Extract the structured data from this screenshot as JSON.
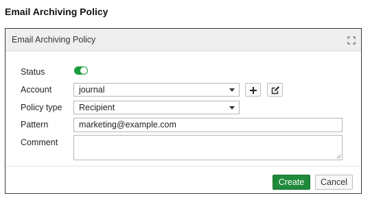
{
  "page": {
    "heading": "Email Archiving Policy"
  },
  "dialog": {
    "title": "Email Archiving Policy",
    "fields": {
      "status": {
        "label": "Status",
        "enabled": true,
        "accent": "#1a9c3e"
      },
      "account": {
        "label": "Account",
        "value": "journal"
      },
      "policy_type": {
        "label": "Policy type",
        "value": "Recipient"
      },
      "pattern": {
        "label": "Pattern",
        "value": "marketing@example.com"
      },
      "comment": {
        "label": "Comment",
        "value": ""
      }
    },
    "buttons": {
      "create": "Create",
      "cancel": "Cancel"
    },
    "colors": {
      "create_button": "#1e8a3a"
    }
  }
}
